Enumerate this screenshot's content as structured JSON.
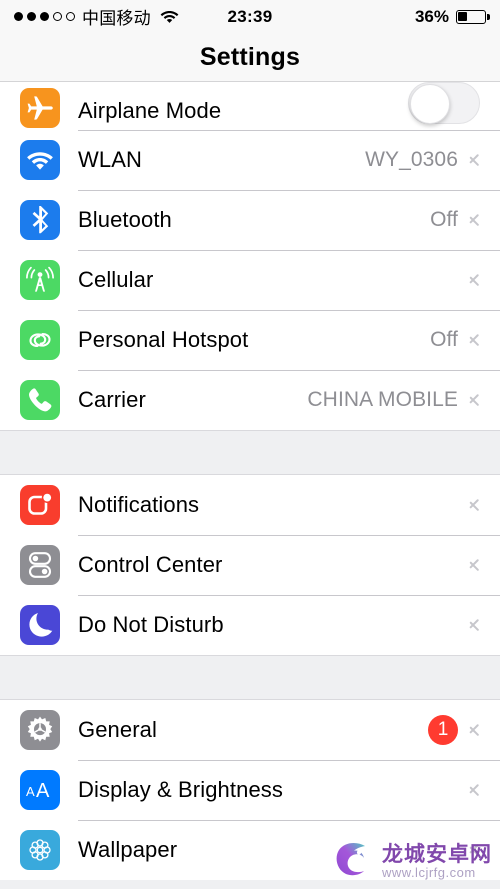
{
  "status_bar": {
    "signal_dots_filled": 3,
    "signal_dots_total": 5,
    "carrier": "中国移动",
    "wifi_icon": "wifi-icon",
    "time": "23:39",
    "battery_percent": "36%",
    "battery_level": 36
  },
  "nav": {
    "title": "Settings"
  },
  "colors": {
    "airplane": "#f7941e",
    "wlan": "#1c7ced",
    "bluetooth": "#1c7ced",
    "cellular": "#4cd964",
    "hotspot": "#4cd964",
    "carrier": "#4cd964",
    "notifications": "#f93d2d",
    "control_center": "#8e8e93",
    "do_not_disturb": "#4a47d6",
    "general": "#8e8e93",
    "display": "#007aff",
    "wallpaper": "#39a9dc",
    "badge": "#ff3b30",
    "chevron": "#c7c7cc",
    "value_text": "#8e8e93",
    "group_bg": "#eff0f2"
  },
  "groups": [
    {
      "rows": [
        {
          "id": "airplane-mode",
          "label": "Airplane Mode",
          "icon": "airplane-icon",
          "icon_color": "#f7941e",
          "accessory": "toggle",
          "toggle_on": false,
          "clipped": true
        },
        {
          "id": "wlan",
          "label": "WLAN",
          "icon": "wifi-icon",
          "icon_color": "#1c7ced",
          "accessory": "chevron",
          "value": "WY_0306"
        },
        {
          "id": "bluetooth",
          "label": "Bluetooth",
          "icon": "bluetooth-icon",
          "icon_color": "#1c7ced",
          "accessory": "chevron",
          "value": "Off"
        },
        {
          "id": "cellular",
          "label": "Cellular",
          "icon": "cellular-antenna-icon",
          "icon_color": "#4cd964",
          "accessory": "chevron",
          "value": ""
        },
        {
          "id": "personal-hotspot",
          "label": "Personal Hotspot",
          "icon": "hotspot-link-icon",
          "icon_color": "#4cd964",
          "accessory": "chevron",
          "value": "Off"
        },
        {
          "id": "carrier",
          "label": "Carrier",
          "icon": "phone-handset-icon",
          "icon_color": "#4cd964",
          "accessory": "chevron",
          "value": "CHINA MOBILE"
        }
      ]
    },
    {
      "rows": [
        {
          "id": "notifications",
          "label": "Notifications",
          "icon": "notifications-icon",
          "icon_color": "#f93d2d",
          "accessory": "chevron",
          "value": ""
        },
        {
          "id": "control-center",
          "label": "Control Center",
          "icon": "control-center-icon",
          "icon_color": "#8e8e93",
          "accessory": "chevron",
          "value": ""
        },
        {
          "id": "do-not-disturb",
          "label": "Do Not Disturb",
          "icon": "moon-icon",
          "icon_color": "#4a47d6",
          "accessory": "chevron",
          "value": ""
        }
      ]
    },
    {
      "rows": [
        {
          "id": "general",
          "label": "General",
          "icon": "gear-icon",
          "icon_color": "#8e8e93",
          "accessory": "chevron",
          "value": "",
          "badge": "1"
        },
        {
          "id": "display-brightness",
          "label": "Display & Brightness",
          "icon": "text-size-aa-icon",
          "icon_color": "#007aff",
          "accessory": "chevron",
          "value": ""
        },
        {
          "id": "wallpaper",
          "label": "Wallpaper",
          "icon": "wallpaper-flower-icon",
          "icon_color": "#39a9dc",
          "accessory": "chevron",
          "value": ""
        }
      ]
    }
  ],
  "watermark": {
    "logo": "dragon-c-logo",
    "title": "龙城安卓网",
    "url": "www.lcjrfg.com"
  }
}
